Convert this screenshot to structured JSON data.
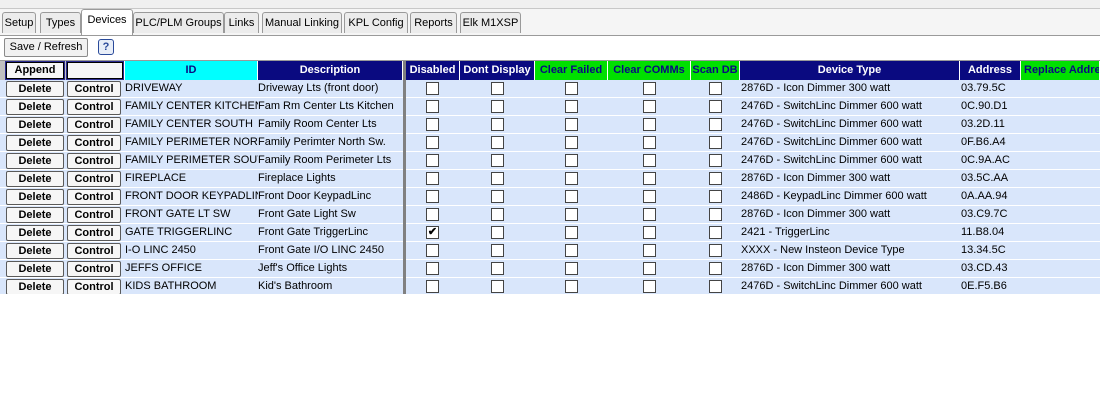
{
  "tabs": [
    "Setup",
    "Types",
    "Devices",
    "PLC/PLM Groups",
    "Links",
    "Manual Linking",
    "KPL Config",
    "Reports",
    "Elk M1XSP"
  ],
  "active_tab": "Devices",
  "toolbar": {
    "save_refresh": "Save / Refresh",
    "help": "?"
  },
  "grid": {
    "header_buttons": {
      "append": "Append",
      "blank": ""
    },
    "columns": {
      "id": "ID",
      "description": "Description",
      "disabled": "Disabled",
      "dont_display": "Dont Display",
      "clear_failed": "Clear Failed",
      "clear_comms": "Clear COMMs",
      "scan_db": "Scan DB",
      "device_type": "Device Type",
      "address": "Address",
      "replace_address": "Replace Addre"
    },
    "row_buttons": {
      "delete": "Delete",
      "control": "Control"
    },
    "rows": [
      {
        "id": "DRIVEWAY",
        "description": "Driveway Lts (front door)",
        "disabled": false,
        "dont_display": false,
        "clear_failed": false,
        "clear_comms": false,
        "scan_db": false,
        "device_type": "2876D - Icon Dimmer 300 watt",
        "address": "03.79.5C"
      },
      {
        "id": "FAMILY CENTER KITCHEN",
        "description": "Fam Rm Center Lts Kitchen",
        "disabled": false,
        "dont_display": false,
        "clear_failed": false,
        "clear_comms": false,
        "scan_db": false,
        "device_type": "2476D - SwitchLinc Dimmer 600 watt",
        "address": "0C.90.D1"
      },
      {
        "id": "FAMILY CENTER SOUTH",
        "description": "Family Room Center Lts",
        "disabled": false,
        "dont_display": false,
        "clear_failed": false,
        "clear_comms": false,
        "scan_db": false,
        "device_type": "2476D - SwitchLinc Dimmer 600 watt",
        "address": "03.2D.11"
      },
      {
        "id": "FAMILY PERIMETER NORTH",
        "description": "Family Perimter North Sw.",
        "disabled": false,
        "dont_display": false,
        "clear_failed": false,
        "clear_comms": false,
        "scan_db": false,
        "device_type": "2476D - SwitchLinc Dimmer 600 watt",
        "address": "0F.B6.A4"
      },
      {
        "id": "FAMILY PERIMETER SOUTH",
        "description": "Family Room Perimeter Lts",
        "disabled": false,
        "dont_display": false,
        "clear_failed": false,
        "clear_comms": false,
        "scan_db": false,
        "device_type": "2476D - SwitchLinc Dimmer 600 watt",
        "address": "0C.9A.AC"
      },
      {
        "id": "FIREPLACE",
        "description": "Fireplace Lights",
        "disabled": false,
        "dont_display": false,
        "clear_failed": false,
        "clear_comms": false,
        "scan_db": false,
        "device_type": "2876D - Icon Dimmer 300 watt",
        "address": "03.5C.AA"
      },
      {
        "id": "FRONT DOOR KEYPADLINC",
        "description": "Front Door KeypadLinc",
        "disabled": false,
        "dont_display": false,
        "clear_failed": false,
        "clear_comms": false,
        "scan_db": false,
        "device_type": "2486D - KeypadLinc Dimmer 600 watt",
        "address": "0A.AA.94"
      },
      {
        "id": "FRONT GATE LT SW",
        "description": "Front Gate Light Sw",
        "disabled": false,
        "dont_display": false,
        "clear_failed": false,
        "clear_comms": false,
        "scan_db": false,
        "device_type": "2876D - Icon Dimmer 300 watt",
        "address": "03.C9.7C"
      },
      {
        "id": "GATE TRIGGERLINC",
        "description": "Front Gate TriggerLinc",
        "disabled": true,
        "dont_display": false,
        "clear_failed": false,
        "clear_comms": false,
        "scan_db": false,
        "device_type": "2421 - TriggerLinc",
        "address": "11.B8.04"
      },
      {
        "id": "I-O LINC 2450",
        "description": "Front Gate I/O LINC 2450",
        "disabled": false,
        "dont_display": false,
        "clear_failed": false,
        "clear_comms": false,
        "scan_db": false,
        "device_type": "XXXX - New Insteon Device Type",
        "address": "13.34.5C"
      },
      {
        "id": "JEFFS OFFICE",
        "description": "Jeff's Office Lights",
        "disabled": false,
        "dont_display": false,
        "clear_failed": false,
        "clear_comms": false,
        "scan_db": false,
        "device_type": "2876D - Icon Dimmer 300 watt",
        "address": "03.CD.43"
      },
      {
        "id": "KIDS BATHROOM",
        "description": "Kid's Bathroom",
        "disabled": false,
        "dont_display": false,
        "clear_failed": false,
        "clear_comms": false,
        "scan_db": false,
        "device_type": "2476D - SwitchLinc Dimmer 600 watt",
        "address": "0E.F5.B6"
      }
    ]
  },
  "colors": {
    "header_navy": "#0a0a80",
    "header_cyan": "#00ffff",
    "header_green": "#00e000",
    "row_background": "#d9e6fb"
  }
}
